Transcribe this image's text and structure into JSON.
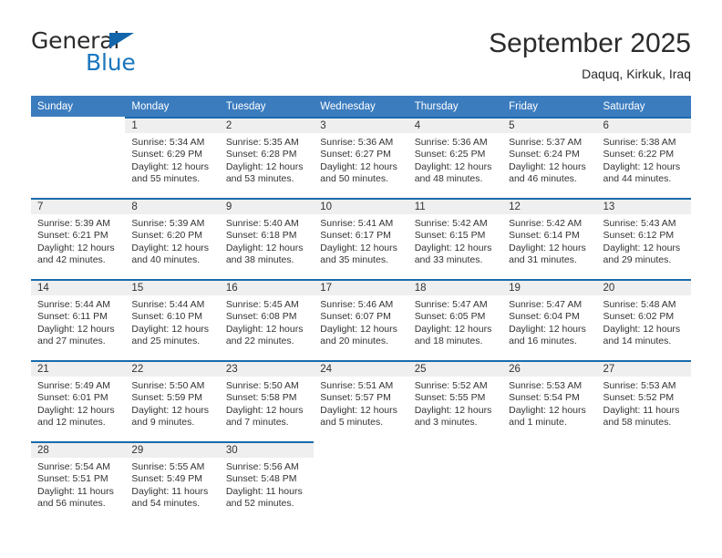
{
  "logo": {
    "line1": "General",
    "line2": "Blue",
    "triangle_color": "#1265ab",
    "line2_color": "#1976be"
  },
  "header": {
    "month_title": "September 2025",
    "location": "Daquq, Kirkuk, Iraq"
  },
  "theme": {
    "header_row_bg": "#3b7cbf",
    "day_band_bg": "#efefef",
    "separator_blue": "#1a6bab",
    "text": "#333333"
  },
  "calendar": {
    "weekday_headers": [
      "Sunday",
      "Monday",
      "Tuesday",
      "Wednesday",
      "Thursday",
      "Friday",
      "Saturday"
    ],
    "weeks": [
      [
        {
          "day": "",
          "sunrise": "",
          "sunset": "",
          "daylight1": "",
          "daylight2": ""
        },
        {
          "day": "1",
          "sunrise": "Sunrise: 5:34 AM",
          "sunset": "Sunset: 6:29 PM",
          "daylight1": "Daylight: 12 hours",
          "daylight2": "and 55 minutes."
        },
        {
          "day": "2",
          "sunrise": "Sunrise: 5:35 AM",
          "sunset": "Sunset: 6:28 PM",
          "daylight1": "Daylight: 12 hours",
          "daylight2": "and 53 minutes."
        },
        {
          "day": "3",
          "sunrise": "Sunrise: 5:36 AM",
          "sunset": "Sunset: 6:27 PM",
          "daylight1": "Daylight: 12 hours",
          "daylight2": "and 50 minutes."
        },
        {
          "day": "4",
          "sunrise": "Sunrise: 5:36 AM",
          "sunset": "Sunset: 6:25 PM",
          "daylight1": "Daylight: 12 hours",
          "daylight2": "and 48 minutes."
        },
        {
          "day": "5",
          "sunrise": "Sunrise: 5:37 AM",
          "sunset": "Sunset: 6:24 PM",
          "daylight1": "Daylight: 12 hours",
          "daylight2": "and 46 minutes."
        },
        {
          "day": "6",
          "sunrise": "Sunrise: 5:38 AM",
          "sunset": "Sunset: 6:22 PM",
          "daylight1": "Daylight: 12 hours",
          "daylight2": "and 44 minutes."
        }
      ],
      [
        {
          "day": "7",
          "sunrise": "Sunrise: 5:39 AM",
          "sunset": "Sunset: 6:21 PM",
          "daylight1": "Daylight: 12 hours",
          "daylight2": "and 42 minutes."
        },
        {
          "day": "8",
          "sunrise": "Sunrise: 5:39 AM",
          "sunset": "Sunset: 6:20 PM",
          "daylight1": "Daylight: 12 hours",
          "daylight2": "and 40 minutes."
        },
        {
          "day": "9",
          "sunrise": "Sunrise: 5:40 AM",
          "sunset": "Sunset: 6:18 PM",
          "daylight1": "Daylight: 12 hours",
          "daylight2": "and 38 minutes."
        },
        {
          "day": "10",
          "sunrise": "Sunrise: 5:41 AM",
          "sunset": "Sunset: 6:17 PM",
          "daylight1": "Daylight: 12 hours",
          "daylight2": "and 35 minutes."
        },
        {
          "day": "11",
          "sunrise": "Sunrise: 5:42 AM",
          "sunset": "Sunset: 6:15 PM",
          "daylight1": "Daylight: 12 hours",
          "daylight2": "and 33 minutes."
        },
        {
          "day": "12",
          "sunrise": "Sunrise: 5:42 AM",
          "sunset": "Sunset: 6:14 PM",
          "daylight1": "Daylight: 12 hours",
          "daylight2": "and 31 minutes."
        },
        {
          "day": "13",
          "sunrise": "Sunrise: 5:43 AM",
          "sunset": "Sunset: 6:12 PM",
          "daylight1": "Daylight: 12 hours",
          "daylight2": "and 29 minutes."
        }
      ],
      [
        {
          "day": "14",
          "sunrise": "Sunrise: 5:44 AM",
          "sunset": "Sunset: 6:11 PM",
          "daylight1": "Daylight: 12 hours",
          "daylight2": "and 27 minutes."
        },
        {
          "day": "15",
          "sunrise": "Sunrise: 5:44 AM",
          "sunset": "Sunset: 6:10 PM",
          "daylight1": "Daylight: 12 hours",
          "daylight2": "and 25 minutes."
        },
        {
          "day": "16",
          "sunrise": "Sunrise: 5:45 AM",
          "sunset": "Sunset: 6:08 PM",
          "daylight1": "Daylight: 12 hours",
          "daylight2": "and 22 minutes."
        },
        {
          "day": "17",
          "sunrise": "Sunrise: 5:46 AM",
          "sunset": "Sunset: 6:07 PM",
          "daylight1": "Daylight: 12 hours",
          "daylight2": "and 20 minutes."
        },
        {
          "day": "18",
          "sunrise": "Sunrise: 5:47 AM",
          "sunset": "Sunset: 6:05 PM",
          "daylight1": "Daylight: 12 hours",
          "daylight2": "and 18 minutes."
        },
        {
          "day": "19",
          "sunrise": "Sunrise: 5:47 AM",
          "sunset": "Sunset: 6:04 PM",
          "daylight1": "Daylight: 12 hours",
          "daylight2": "and 16 minutes."
        },
        {
          "day": "20",
          "sunrise": "Sunrise: 5:48 AM",
          "sunset": "Sunset: 6:02 PM",
          "daylight1": "Daylight: 12 hours",
          "daylight2": "and 14 minutes."
        }
      ],
      [
        {
          "day": "21",
          "sunrise": "Sunrise: 5:49 AM",
          "sunset": "Sunset: 6:01 PM",
          "daylight1": "Daylight: 12 hours",
          "daylight2": "and 12 minutes."
        },
        {
          "day": "22",
          "sunrise": "Sunrise: 5:50 AM",
          "sunset": "Sunset: 5:59 PM",
          "daylight1": "Daylight: 12 hours",
          "daylight2": "and 9 minutes."
        },
        {
          "day": "23",
          "sunrise": "Sunrise: 5:50 AM",
          "sunset": "Sunset: 5:58 PM",
          "daylight1": "Daylight: 12 hours",
          "daylight2": "and 7 minutes."
        },
        {
          "day": "24",
          "sunrise": "Sunrise: 5:51 AM",
          "sunset": "Sunset: 5:57 PM",
          "daylight1": "Daylight: 12 hours",
          "daylight2": "and 5 minutes."
        },
        {
          "day": "25",
          "sunrise": "Sunrise: 5:52 AM",
          "sunset": "Sunset: 5:55 PM",
          "daylight1": "Daylight: 12 hours",
          "daylight2": "and 3 minutes."
        },
        {
          "day": "26",
          "sunrise": "Sunrise: 5:53 AM",
          "sunset": "Sunset: 5:54 PM",
          "daylight1": "Daylight: 12 hours",
          "daylight2": "and 1 minute."
        },
        {
          "day": "27",
          "sunrise": "Sunrise: 5:53 AM",
          "sunset": "Sunset: 5:52 PM",
          "daylight1": "Daylight: 11 hours",
          "daylight2": "and 58 minutes."
        }
      ],
      [
        {
          "day": "28",
          "sunrise": "Sunrise: 5:54 AM",
          "sunset": "Sunset: 5:51 PM",
          "daylight1": "Daylight: 11 hours",
          "daylight2": "and 56 minutes."
        },
        {
          "day": "29",
          "sunrise": "Sunrise: 5:55 AM",
          "sunset": "Sunset: 5:49 PM",
          "daylight1": "Daylight: 11 hours",
          "daylight2": "and 54 minutes."
        },
        {
          "day": "30",
          "sunrise": "Sunrise: 5:56 AM",
          "sunset": "Sunset: 5:48 PM",
          "daylight1": "Daylight: 11 hours",
          "daylight2": "and 52 minutes."
        },
        {
          "day": "",
          "sunrise": "",
          "sunset": "",
          "daylight1": "",
          "daylight2": ""
        },
        {
          "day": "",
          "sunrise": "",
          "sunset": "",
          "daylight1": "",
          "daylight2": ""
        },
        {
          "day": "",
          "sunrise": "",
          "sunset": "",
          "daylight1": "",
          "daylight2": ""
        },
        {
          "day": "",
          "sunrise": "",
          "sunset": "",
          "daylight1": "",
          "daylight2": ""
        }
      ]
    ]
  }
}
